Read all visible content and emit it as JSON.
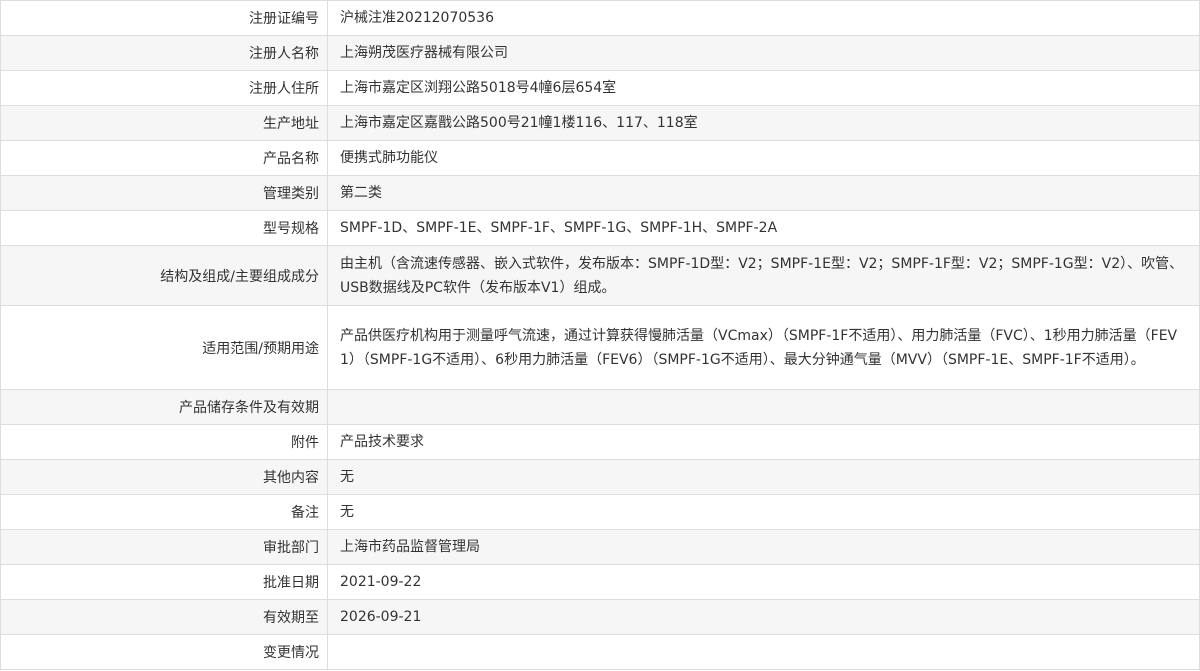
{
  "rows": [
    {
      "label": "注册证编号",
      "value": "沪械注准20212070536"
    },
    {
      "label": "注册人名称",
      "value": "上海朔茂医疗器械有限公司"
    },
    {
      "label": "注册人住所",
      "value": "上海市嘉定区浏翔公路5018号4幢6层654室"
    },
    {
      "label": "生产地址",
      "value": "上海市嘉定区嘉戬公路500号21幢1楼116、117、118室"
    },
    {
      "label": "产品名称",
      "value": "便携式肺功能仪"
    },
    {
      "label": "管理类别",
      "value": "第二类"
    },
    {
      "label": "型号规格",
      "value": "SMPF-1D、SMPF-1E、SMPF-1F、SMPF-1G、SMPF-1H、SMPF-2A"
    },
    {
      "label": "结构及组成/主要组成成分",
      "value": "由主机（含流速传感器、嵌入式软件，发布版本：SMPF-1D型：V2；SMPF-1E型：V2；SMPF-1F型：V2；SMPF-1G型：V2）、吹管、USB数据线及PC软件（发布版本V1）组成。"
    },
    {
      "label": "适用范围/预期用途",
      "value": "产品供医疗机构用于测量呼气流速，通过计算获得慢肺活量（VCmax）（SMPF-1F不适用）、用力肺活量（FVC）、1秒用力肺活量（FEV1）（SMPF-1G不适用）、6秒用力肺活量（FEV6）（SMPF-1G不适用）、最大分钟通气量（MVV）（SMPF-1E、SMPF-1F不适用）。"
    },
    {
      "label": "产品储存条件及有效期",
      "value": ""
    },
    {
      "label": "附件",
      "value": "产品技术要求"
    },
    {
      "label": "其他内容",
      "value": "无"
    },
    {
      "label": "备注",
      "value": "无"
    },
    {
      "label": "审批部门",
      "value": "上海市药品监督管理局"
    },
    {
      "label": "批准日期",
      "value": "2021-09-22"
    },
    {
      "label": "有效期至",
      "value": "2026-09-21"
    },
    {
      "label": "变更情况",
      "value": ""
    }
  ]
}
